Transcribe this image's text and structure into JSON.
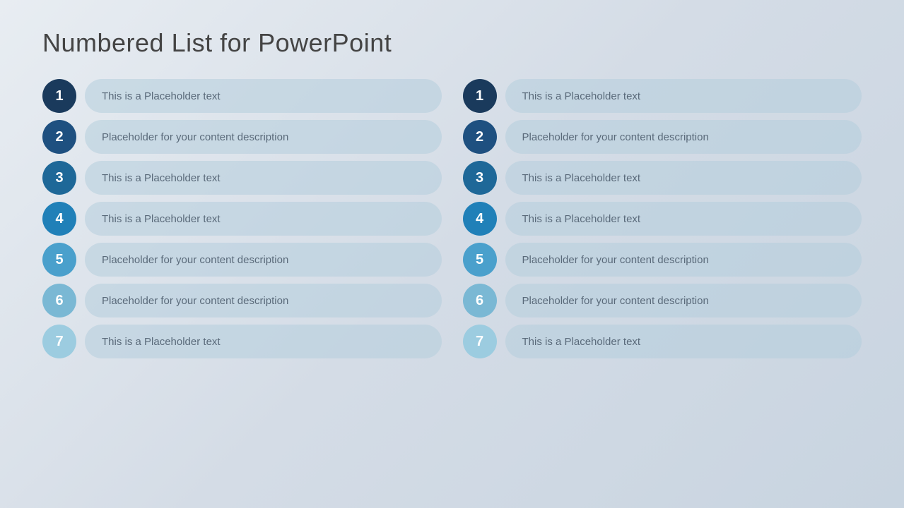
{
  "title": "Numbered List for PowerPoint",
  "columns": [
    {
      "items": [
        {
          "number": 1,
          "text": "This is a Placeholder text",
          "colorClass": "num-1"
        },
        {
          "number": 2,
          "text": "Placeholder for your content description",
          "colorClass": "num-2"
        },
        {
          "number": 3,
          "text": "This is a Placeholder text",
          "colorClass": "num-3"
        },
        {
          "number": 4,
          "text": "This is a Placeholder text",
          "colorClass": "num-4"
        },
        {
          "number": 5,
          "text": "Placeholder for your content description",
          "colorClass": "num-5"
        },
        {
          "number": 6,
          "text": "Placeholder for your content description",
          "colorClass": "num-6"
        },
        {
          "number": 7,
          "text": "This is a Placeholder text",
          "colorClass": "num-7"
        }
      ]
    },
    {
      "items": [
        {
          "number": 1,
          "text": "This is a Placeholder text",
          "colorClass": "num-1"
        },
        {
          "number": 2,
          "text": "Placeholder for your content description",
          "colorClass": "num-2"
        },
        {
          "number": 3,
          "text": "This is a Placeholder text",
          "colorClass": "num-3"
        },
        {
          "number": 4,
          "text": "This is a Placeholder text",
          "colorClass": "num-4"
        },
        {
          "number": 5,
          "text": "Placeholder for your content description",
          "colorClass": "num-5"
        },
        {
          "number": 6,
          "text": "Placeholder for your content description",
          "colorClass": "num-6"
        },
        {
          "number": 7,
          "text": "This is a Placeholder text",
          "colorClass": "num-7"
        }
      ]
    }
  ]
}
